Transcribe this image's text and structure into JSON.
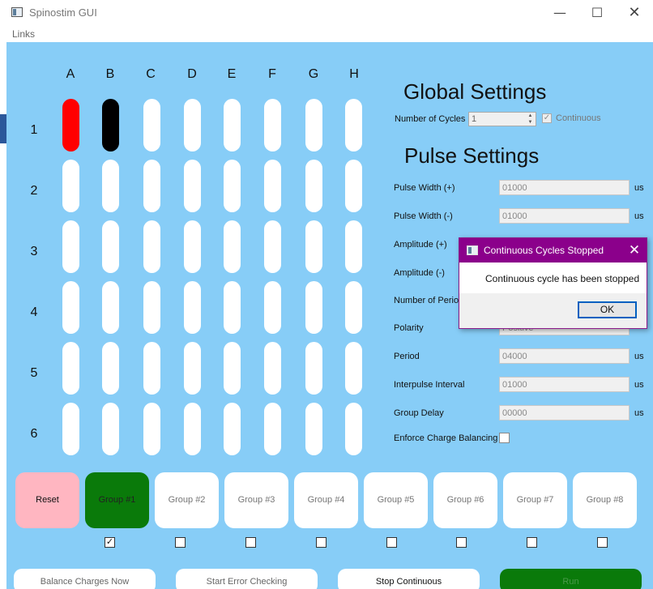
{
  "window": {
    "title": "Spinostim GUI",
    "minimize_glyph": "—",
    "maximize_glyph": "☐",
    "close_glyph": "✕"
  },
  "menu": {
    "links_label": "Links"
  },
  "plate": {
    "columns": [
      "A",
      "B",
      "C",
      "D",
      "E",
      "F",
      "G",
      "H"
    ],
    "rows": [
      "1",
      "2",
      "3",
      "4",
      "5",
      "6"
    ],
    "highlighted_wells": [
      {
        "well": "A1",
        "color": "#ff0000"
      },
      {
        "well": "B1",
        "color": "#000000"
      }
    ]
  },
  "global_settings": {
    "heading": "Global Settings",
    "cycles_label": "Number of Cycles",
    "cycles_value": "1",
    "continuous_label": "Continuous",
    "continuous_checked": true
  },
  "pulse_settings": {
    "heading": "Pulse Settings",
    "pulse_width_pos_label": "Pulse Width (+)",
    "pulse_width_pos_value": "01000",
    "pulse_width_pos_unit": "us",
    "pulse_width_neg_label": "Pulse Width (-)",
    "pulse_width_neg_value": "01000",
    "pulse_width_neg_unit": "us",
    "amplitude_pos_label": "Amplitude (+)",
    "amplitude_neg_label": "Amplitude (-)",
    "num_periods_label": "Number of Period",
    "polarity_label": "Polarity",
    "polarity_value": "Positive",
    "period_label": "Period",
    "period_value": "04000",
    "period_unit": "us",
    "interpulse_label": "Interpulse Interval",
    "interpulse_value": "01000",
    "interpulse_unit": "us",
    "group_delay_label": "Group Delay",
    "group_delay_value": "00000",
    "group_delay_unit": "us",
    "charge_balance_label": "Enforce Charge Balancing",
    "charge_balance_checked": false
  },
  "groups": {
    "reset_label": "Reset",
    "buttons": [
      "Group #1",
      "Group #2",
      "Group #3",
      "Group #4",
      "Group #5",
      "Group #6",
      "Group #7",
      "Group #8"
    ],
    "checked": [
      true,
      false,
      false,
      false,
      false,
      false,
      false,
      false
    ],
    "check_glyph": "✓"
  },
  "actions": {
    "balance_label": "Balance Charges Now",
    "error_check_label": "Start Error Checking",
    "stop_label": "Stop Continuous",
    "run_label": "Run"
  },
  "colors": {
    "background": "#87cdf7",
    "active_green": "#0a7a0a",
    "reset_pink": "#ffb6c1",
    "dialog_title": "#8b008b"
  },
  "dialog": {
    "title": "Continuous Cycles Stopped",
    "message": "Continuous cycle has been stopped",
    "ok_label": "OK",
    "close_glyph": "✕"
  }
}
